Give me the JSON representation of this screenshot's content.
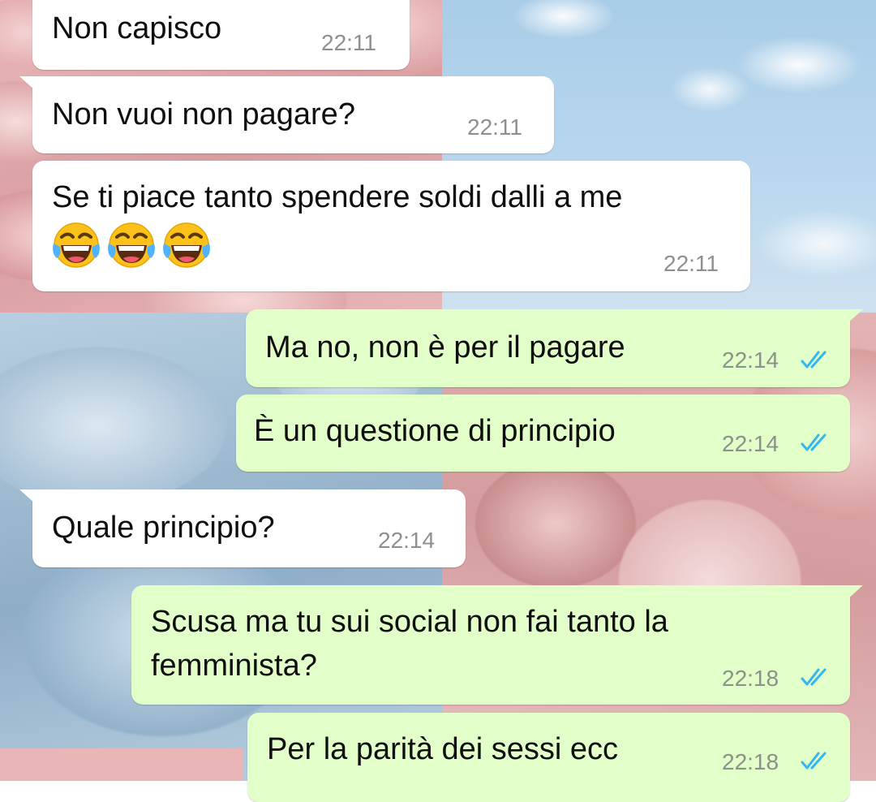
{
  "messages": [
    {
      "direction": "in",
      "text": "Non capisco",
      "time": "22:11"
    },
    {
      "direction": "in",
      "text": "Non vuoi non pagare?",
      "time": "22:11"
    },
    {
      "direction": "in",
      "text": "Se ti piace tanto spendere soldi dalli a me",
      "emoji": [
        "face-with-tears-of-joy",
        "face-with-tears-of-joy",
        "face-with-tears-of-joy"
      ],
      "time": "22:11"
    },
    {
      "direction": "out",
      "text": "Ma no, non è per il pagare",
      "time": "22:14",
      "status": "read"
    },
    {
      "direction": "out",
      "text": "È un questione di principio",
      "time": "22:14",
      "status": "read"
    },
    {
      "direction": "in",
      "text": "Quale principio?",
      "time": "22:14"
    },
    {
      "direction": "out",
      "lines": [
        "Scusa ma tu sui social non fai tanto la",
        "femminista?"
      ],
      "time": "22:18",
      "status": "read"
    },
    {
      "direction": "out",
      "text": "Per la parità dei sessi ecc",
      "time": "22:18",
      "status": "read"
    }
  ],
  "colors": {
    "incoming_bubble": "#ffffff",
    "outgoing_bubble": "#e2fec9",
    "read_ticks": "#34b7f1",
    "timestamp": "#8f8f8f"
  },
  "icons": {
    "read_status": "double-check-icon",
    "emoji": "face-with-tears-of-joy"
  }
}
